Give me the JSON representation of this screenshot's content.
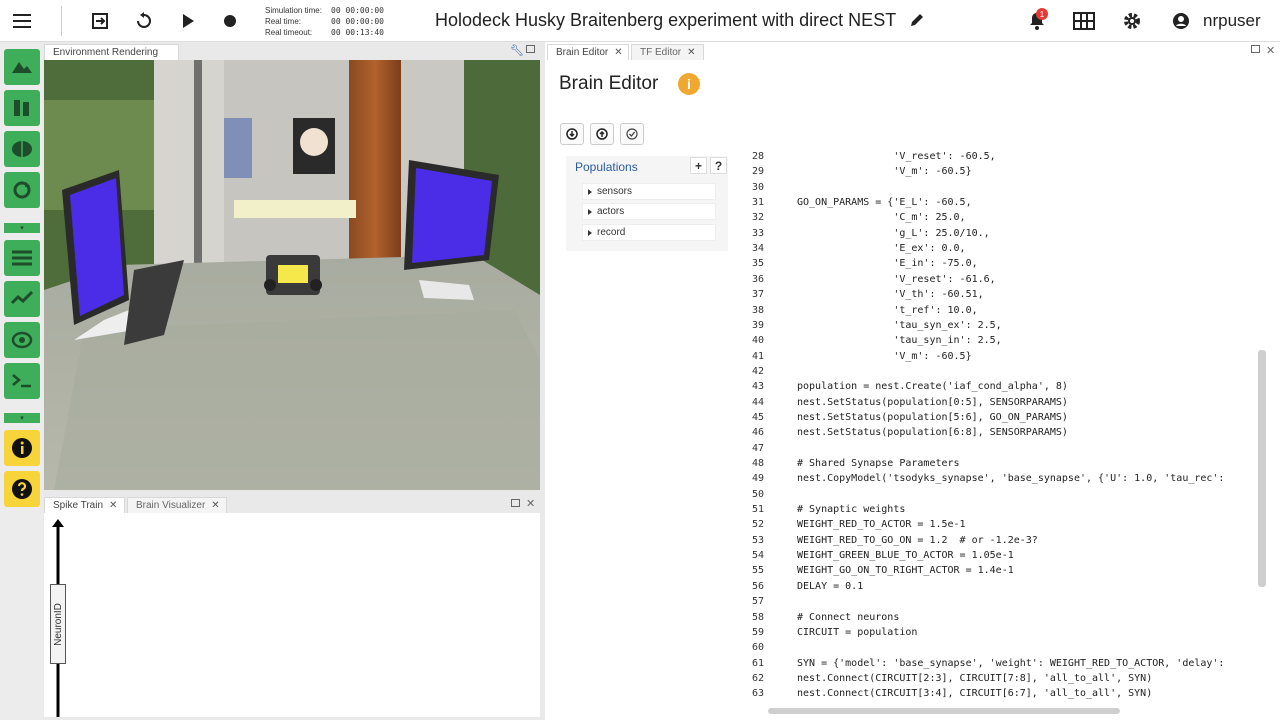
{
  "topbar": {
    "title": "Holodeck Husky Braitenberg experiment with direct NEST",
    "sim_time_label": "Simulation time:",
    "sim_time_value": "00 00:00:00",
    "real_time_label": "Real time:",
    "real_time_value": "00 00:00:00",
    "real_timeout_label": "Real timeout:",
    "real_timeout_value": "00 00:13:40",
    "notification_count": "1",
    "username": "nrpuser"
  },
  "env_panel": {
    "tab": "Environment Rendering"
  },
  "spike_panel": {
    "tab_spike": "Spike Train",
    "tab_brain_vis": "Brain Visualizer",
    "y_label": "NeuronID"
  },
  "right_panel": {
    "tab_brain": "Brain Editor",
    "tab_tf": "TF Editor",
    "heading": "Brain Editor"
  },
  "populations": {
    "header": "Populations",
    "plus": "+",
    "help": "?",
    "items": [
      "sensors",
      "actors",
      "record"
    ]
  },
  "code_lines": [
    {
      "n": "28",
      "t": "                'V_reset': -60.5,"
    },
    {
      "n": "29",
      "t": "                'V_m': -60.5}"
    },
    {
      "n": "30",
      "t": ""
    },
    {
      "n": "31",
      "t": "GO_ON_PARAMS = {'E_L': -60.5,"
    },
    {
      "n": "32",
      "t": "                'C_m': 25.0,"
    },
    {
      "n": "33",
      "t": "                'g_L': 25.0/10.,"
    },
    {
      "n": "34",
      "t": "                'E_ex': 0.0,"
    },
    {
      "n": "35",
      "t": "                'E_in': -75.0,"
    },
    {
      "n": "36",
      "t": "                'V_reset': -61.6,"
    },
    {
      "n": "37",
      "t": "                'V_th': -60.51,"
    },
    {
      "n": "38",
      "t": "                't_ref': 10.0,"
    },
    {
      "n": "39",
      "t": "                'tau_syn_ex': 2.5,"
    },
    {
      "n": "40",
      "t": "                'tau_syn_in': 2.5,"
    },
    {
      "n": "41",
      "t": "                'V_m': -60.5}"
    },
    {
      "n": "42",
      "t": ""
    },
    {
      "n": "43",
      "t": "population = nest.Create('iaf_cond_alpha', 8)"
    },
    {
      "n": "44",
      "t": "nest.SetStatus(population[0:5], SENSORPARAMS)"
    },
    {
      "n": "45",
      "t": "nest.SetStatus(population[5:6], GO_ON_PARAMS)"
    },
    {
      "n": "46",
      "t": "nest.SetStatus(population[6:8], SENSORPARAMS)"
    },
    {
      "n": "47",
      "t": ""
    },
    {
      "n": "48",
      "t": "# Shared Synapse Parameters"
    },
    {
      "n": "49",
      "t": "nest.CopyModel('tsodyks_synapse', 'base_synapse', {'U': 1.0, 'tau_rec':"
    },
    {
      "n": "50",
      "t": ""
    },
    {
      "n": "51",
      "t": "# Synaptic weights"
    },
    {
      "n": "52",
      "t": "WEIGHT_RED_TO_ACTOR = 1.5e-1"
    },
    {
      "n": "53",
      "t": "WEIGHT_RED_TO_GO_ON = 1.2  # or -1.2e-3?"
    },
    {
      "n": "54",
      "t": "WEIGHT_GREEN_BLUE_TO_ACTOR = 1.05e-1"
    },
    {
      "n": "55",
      "t": "WEIGHT_GO_ON_TO_RIGHT_ACTOR = 1.4e-1"
    },
    {
      "n": "56",
      "t": "DELAY = 0.1"
    },
    {
      "n": "57",
      "t": ""
    },
    {
      "n": "58",
      "t": "# Connect neurons"
    },
    {
      "n": "59",
      "t": "CIRCUIT = population"
    },
    {
      "n": "60",
      "t": ""
    },
    {
      "n": "61",
      "t": "SYN = {'model': 'base_synapse', 'weight': WEIGHT_RED_TO_ACTOR, 'delay':"
    },
    {
      "n": "62",
      "t": "nest.Connect(CIRCUIT[2:3], CIRCUIT[7:8], 'all_to_all', SYN)"
    },
    {
      "n": "63",
      "t": "nest.Connect(CIRCUIT[3:4], CIRCUIT[6:7], 'all_to_all', SYN)"
    }
  ],
  "colors": {
    "sidebar_green": "#3fae5a",
    "sidebar_yellow": "#f7d43a",
    "info_orange": "#f0a830",
    "badge_red": "#e53935"
  },
  "icons": {
    "sidebar": [
      "landscape-icon",
      "object-library-icon",
      "brain-icon",
      "reset-icon",
      "plot-icon",
      "chart-icon",
      "brain-gear-icon",
      "terminal-icon",
      "info-icon",
      "help-icon"
    ]
  }
}
